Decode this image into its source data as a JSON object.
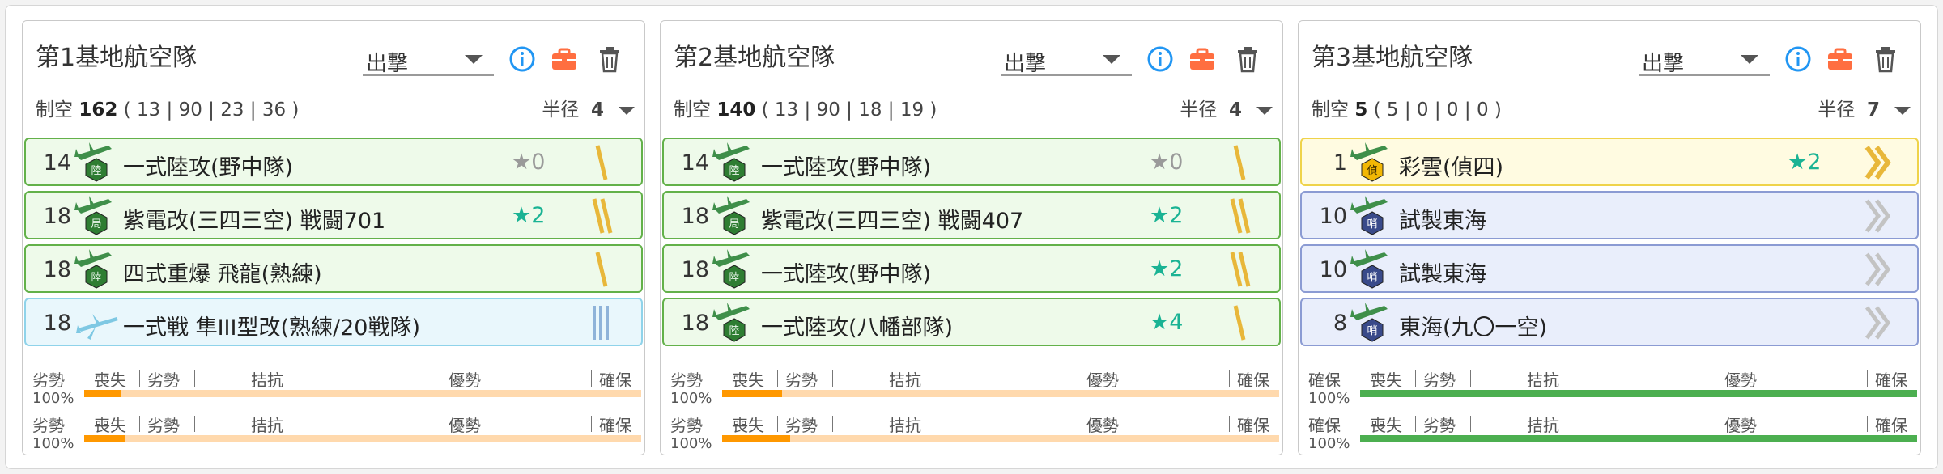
{
  "panels": [
    {
      "title": "第1基地航空隊",
      "mode": "出撃",
      "summary": {
        "label": "制空",
        "value": "162",
        "detail": "( 13 | 90 | 23 | 36 )",
        "radius_label": "半径",
        "radius_value": "4"
      },
      "rows": [
        {
          "count": "14",
          "name": "一式陸攻(野中隊)",
          "star": "★0",
          "star_gray": true,
          "plane": "attacker",
          "badge": "陸",
          "prof": "1"
        },
        {
          "count": "18",
          "name": "紫電改(三四三空) 戦闘701",
          "star": "★2",
          "star_gray": false,
          "plane": "attacker",
          "badge": "局",
          "prof": "2"
        },
        {
          "count": "18",
          "name": "四式重爆 飛龍(熟練)",
          "star": "",
          "star_gray": false,
          "plane": "attacker",
          "badge": "陸",
          "prof": "1"
        },
        {
          "count": "18",
          "name": "一式戦 隼III型改(熟練/20戦隊)",
          "star": "",
          "star_gray": false,
          "plane": "fighter",
          "badge": "",
          "prof": "3"
        }
      ],
      "bars": [
        {
          "status": "劣勢",
          "pct": "100%",
          "fill": 0.065,
          "fill_color": "#ff9800"
        },
        {
          "status": "劣勢",
          "pct": "100%",
          "fill": 0.073,
          "fill_color": "#ff9800"
        }
      ]
    },
    {
      "title": "第2基地航空隊",
      "mode": "出撃",
      "summary": {
        "label": "制空",
        "value": "140",
        "detail": "( 13 | 90 | 18 | 19 )",
        "radius_label": "半径",
        "radius_value": "4"
      },
      "rows": [
        {
          "count": "14",
          "name": "一式陸攻(野中隊)",
          "star": "★0",
          "star_gray": true,
          "plane": "attacker",
          "badge": "陸",
          "prof": "1"
        },
        {
          "count": "18",
          "name": "紫電改(三四三空) 戦闘407",
          "star": "★2",
          "star_gray": false,
          "plane": "attacker",
          "badge": "局",
          "prof": "2"
        },
        {
          "count": "18",
          "name": "一式陸攻(野中隊)",
          "star": "★2",
          "star_gray": false,
          "plane": "attacker",
          "badge": "陸",
          "prof": "2"
        },
        {
          "count": "18",
          "name": "一式陸攻(八幡部隊)",
          "star": "★4",
          "star_gray": false,
          "plane": "attacker",
          "badge": "陸",
          "prof": "1"
        }
      ],
      "bars": [
        {
          "status": "劣勢",
          "pct": "100%",
          "fill": 0.108,
          "fill_color": "#ff9800"
        },
        {
          "status": "劣勢",
          "pct": "100%",
          "fill": 0.122,
          "fill_color": "#ff9800"
        }
      ]
    },
    {
      "title": "第3基地航空隊",
      "mode": "出撃",
      "summary": {
        "label": "制空",
        "value": "5",
        "detail": "( 5 | 0 | 0 | 0 )",
        "radius_label": "半径",
        "radius_value": "7"
      },
      "rows": [
        {
          "count": "1",
          "name": "彩雲(偵四)",
          "star": "★2",
          "star_gray": false,
          "plane": "recon",
          "badge": "偵",
          "prof": "chev"
        },
        {
          "count": "10",
          "name": "試製東海",
          "star": "",
          "star_gray": false,
          "plane": "patrol",
          "badge": "哨",
          "prof": "chevgray"
        },
        {
          "count": "10",
          "name": "試製東海",
          "star": "",
          "star_gray": false,
          "plane": "patrol",
          "badge": "哨",
          "prof": "chevgray"
        },
        {
          "count": "8",
          "name": "東海(九〇一空)",
          "star": "",
          "star_gray": false,
          "plane": "patrol",
          "badge": "哨",
          "prof": "chevgray"
        }
      ],
      "bars": [
        {
          "status": "確保",
          "pct": "100%",
          "fill": 1.0,
          "fill_color": "#4caf50"
        },
        {
          "status": "確保",
          "pct": "100%",
          "fill": 1.0,
          "fill_color": "#4caf50"
        }
      ]
    }
  ],
  "bar_scale": {
    "labels": [
      "喪失",
      "劣勢",
      "拮抗",
      "優勢",
      "確保"
    ]
  },
  "colors": {
    "info": "#2196f3",
    "toolbox": "#ff6e40",
    "star": "#1ab394",
    "green_border": "#63b14a"
  },
  "icons": {
    "info": "info-icon",
    "toolbox": "toolbox-icon",
    "delete": "trash-icon",
    "dropdown": "chevron-down-icon"
  }
}
